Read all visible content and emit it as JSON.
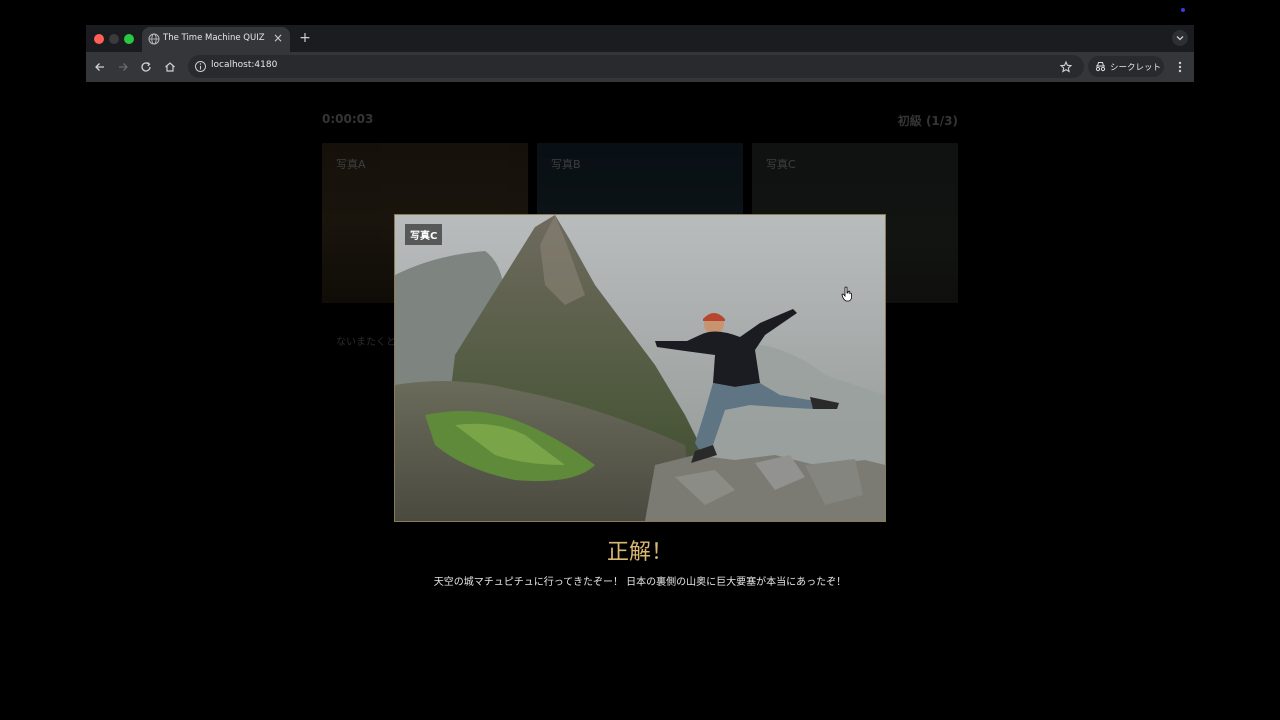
{
  "browser": {
    "tab_title": "The Time Machine QUIZ",
    "close_glyph": "×",
    "new_tab_glyph": "+",
    "url": "localhost:4180",
    "incognito_label": "シークレット"
  },
  "game": {
    "timer": "0:00:03",
    "level": "初級 (1/3)",
    "photos": [
      {
        "label": "写真A"
      },
      {
        "label": "写真B"
      },
      {
        "label": "写真C"
      }
    ],
    "hint": "ないまたくとないまだだよ"
  },
  "modal": {
    "photo_label": "写真C",
    "result_title": "正解！",
    "message": "天空の城マチュピチュに行ってきたぞー！ 日本の裏側の山奥に巨大要塞が本当にあったぞ！"
  },
  "colors": {
    "result": "#d8b872",
    "page_background": "#000000",
    "toolbar": "#353639",
    "tabbar": "#1b1c1f"
  }
}
